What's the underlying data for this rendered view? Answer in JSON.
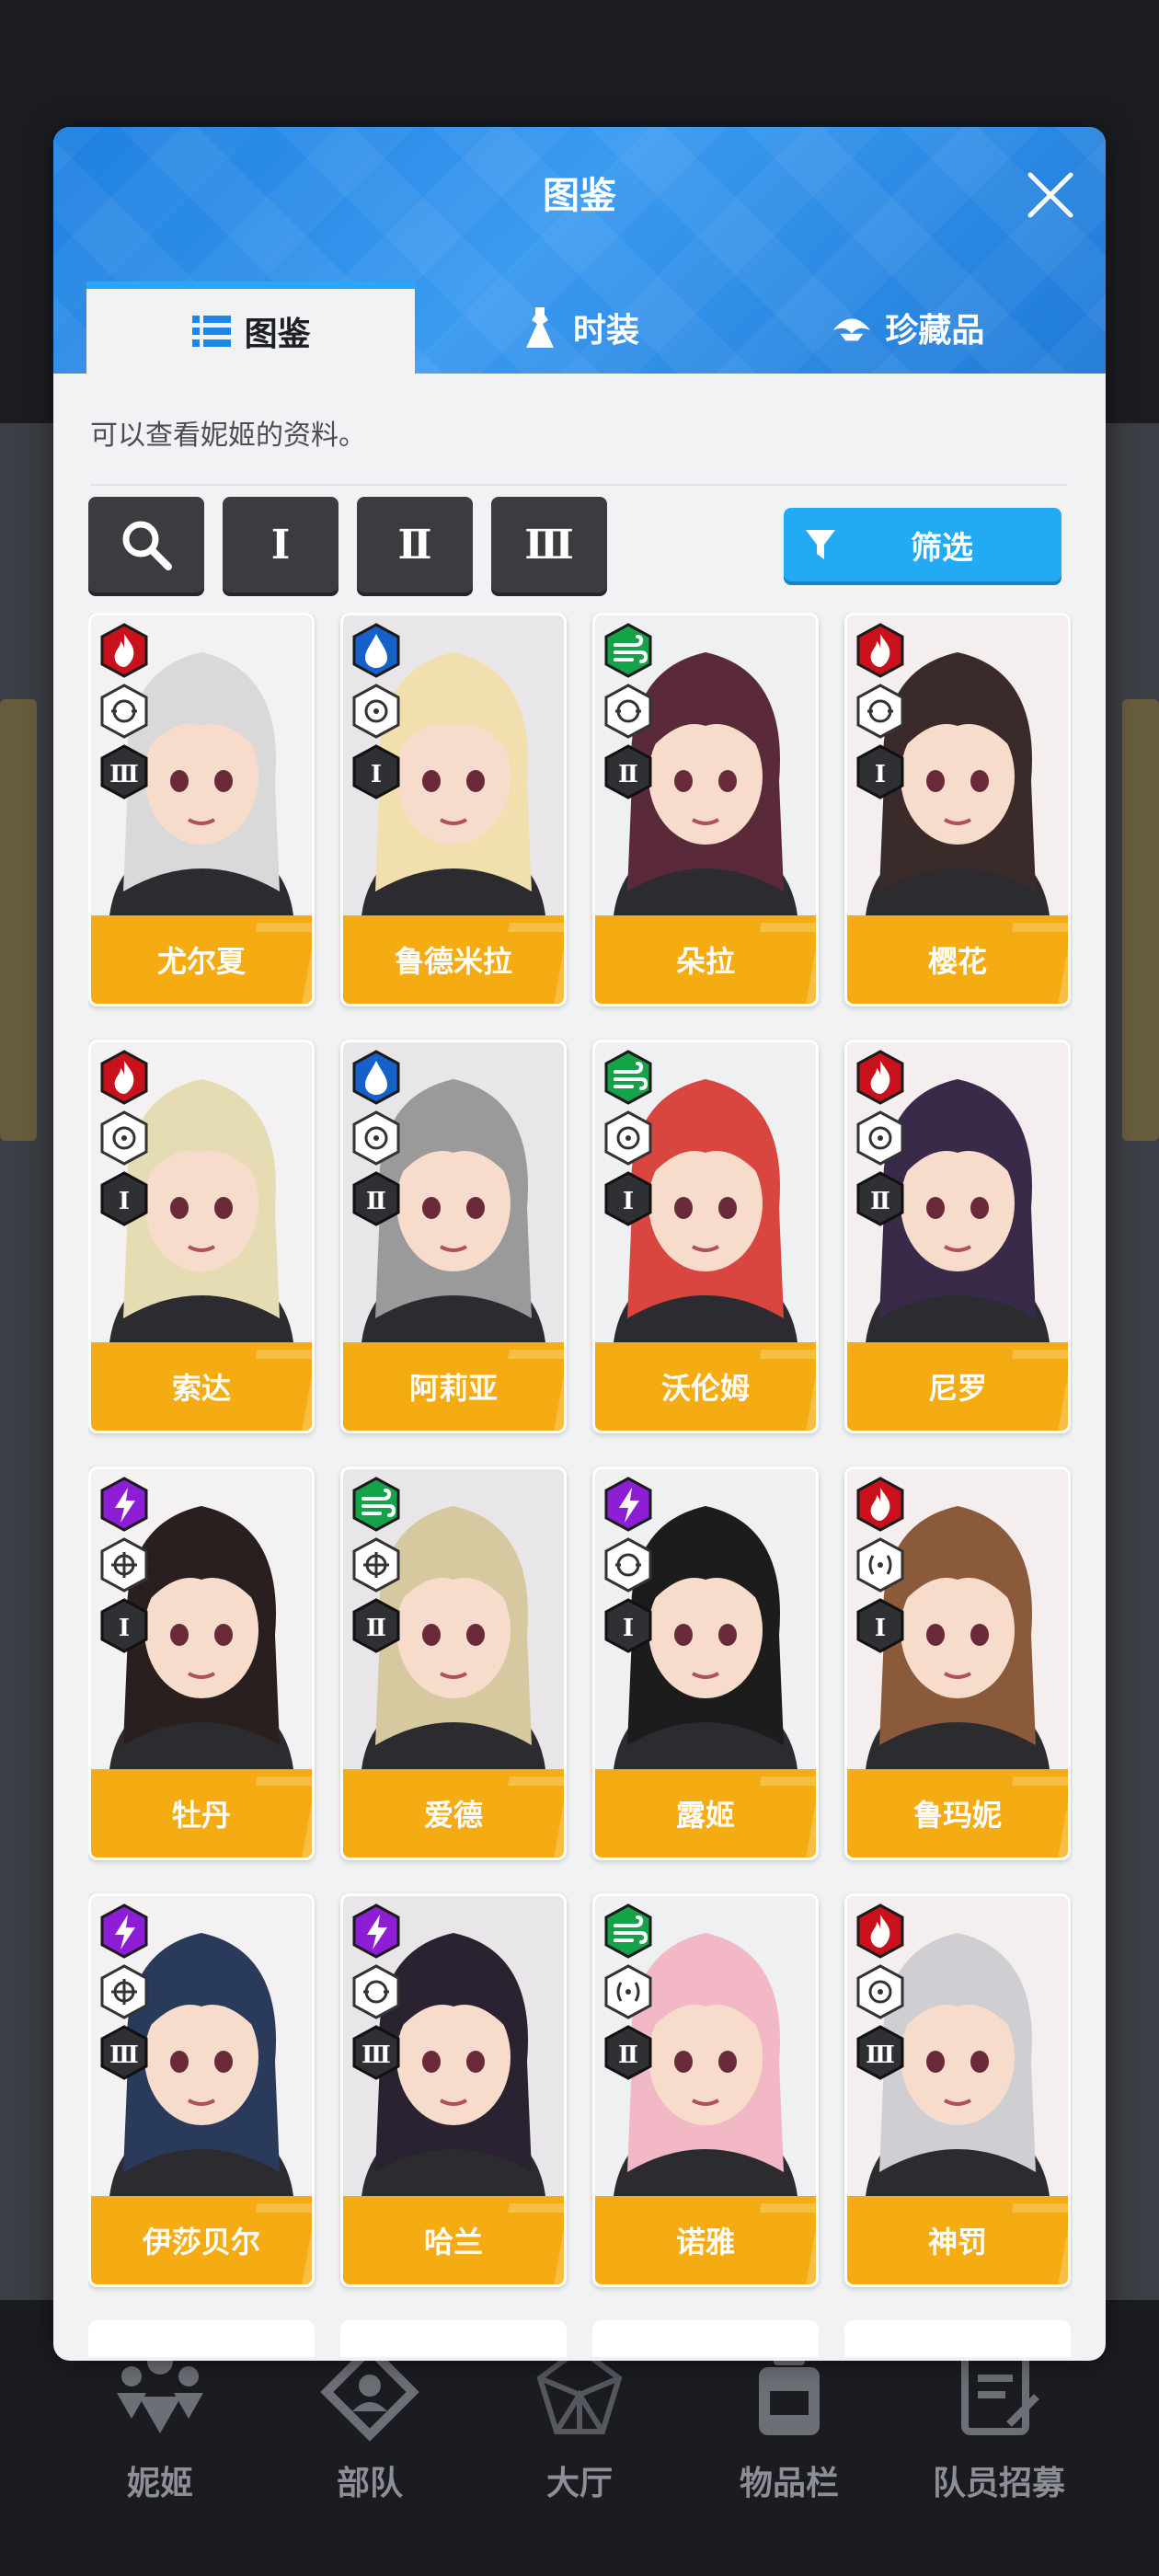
{
  "modal": {
    "title": "图鉴",
    "tabs": [
      {
        "label": "图鉴",
        "icon": "list-icon",
        "active": true
      },
      {
        "label": "时装",
        "icon": "dress-icon",
        "active": false
      },
      {
        "label": "珍藏品",
        "icon": "treasure-icon",
        "active": false
      }
    ],
    "description": "可以查看妮姬的资料。",
    "toolbar": {
      "search_icon": "search-icon",
      "burst_filters": [
        "Ⅰ",
        "Ⅱ",
        "Ⅲ"
      ],
      "filter_label": "筛选",
      "filter_icon": "funnel-icon"
    }
  },
  "colors": {
    "header_blue": "#1e7fe0",
    "accent_blue": "#22aaf5",
    "name_bar": "#f5ac13",
    "fire": "#c8111b",
    "water": "#1560c9",
    "wind": "#15a34a",
    "electric": "#8e1dd6"
  },
  "characters": [
    {
      "name": "尤尔夏",
      "element": "fire",
      "weapon": "ring-scope",
      "burst": "Ⅲ",
      "hair": "#d9d9d9"
    },
    {
      "name": "鲁德米拉",
      "element": "water",
      "weapon": "dot-scope",
      "burst": "Ⅰ",
      "hair": "#f2dfae"
    },
    {
      "name": "朵拉",
      "element": "wind",
      "weapon": "ring-scope",
      "burst": "Ⅱ",
      "hair": "#5a2a3a"
    },
    {
      "name": "樱花",
      "element": "fire",
      "weapon": "ring-scope",
      "burst": "Ⅰ",
      "hair": "#3a2a2a"
    },
    {
      "name": "索达",
      "element": "fire",
      "weapon": "dot-scope",
      "burst": "Ⅰ",
      "hair": "#e6dcb4"
    },
    {
      "name": "阿莉亚",
      "element": "water",
      "weapon": "dot-scope",
      "burst": "Ⅱ",
      "hair": "#9a9a9a"
    },
    {
      "name": "沃伦姆",
      "element": "wind",
      "weapon": "dot-scope",
      "burst": "Ⅰ",
      "hair": "#d9453f"
    },
    {
      "name": "尼罗",
      "element": "fire",
      "weapon": "dot-scope",
      "burst": "Ⅱ",
      "hair": "#3a2a4a"
    },
    {
      "name": "牡丹",
      "element": "electric",
      "weapon": "crosshair",
      "burst": "Ⅰ",
      "hair": "#2a1f1f"
    },
    {
      "name": "爱德",
      "element": "wind",
      "weapon": "crosshair",
      "burst": "Ⅱ",
      "hair": "#d6c9a0"
    },
    {
      "name": "露姬",
      "element": "electric",
      "weapon": "ring-scope",
      "burst": "Ⅰ",
      "hair": "#1c1c1c"
    },
    {
      "name": "鲁玛妮",
      "element": "fire",
      "weapon": "bracket",
      "burst": "Ⅰ",
      "hair": "#8a5a3a"
    },
    {
      "name": "伊莎贝尔",
      "element": "electric",
      "weapon": "crosshair",
      "burst": "Ⅲ",
      "hair": "#2a3a5a"
    },
    {
      "name": "哈兰",
      "element": "electric",
      "weapon": "ring-scope",
      "burst": "Ⅲ",
      "hair": "#2a2230"
    },
    {
      "name": "诺雅",
      "element": "wind",
      "weapon": "bracket",
      "burst": "Ⅱ",
      "hair": "#f2b8c6"
    },
    {
      "name": "神罚",
      "element": "fire",
      "weapon": "dot-scope",
      "burst": "Ⅲ",
      "hair": "#cfcfd3"
    }
  ],
  "bottom_nav": [
    {
      "label": "妮姬",
      "icon": "people-icon"
    },
    {
      "label": "部队",
      "icon": "squad-icon"
    },
    {
      "label": "大厅",
      "icon": "gem-icon"
    },
    {
      "label": "物品栏",
      "icon": "backpack-icon"
    },
    {
      "label": "队员招募",
      "icon": "recruit-icon"
    }
  ]
}
